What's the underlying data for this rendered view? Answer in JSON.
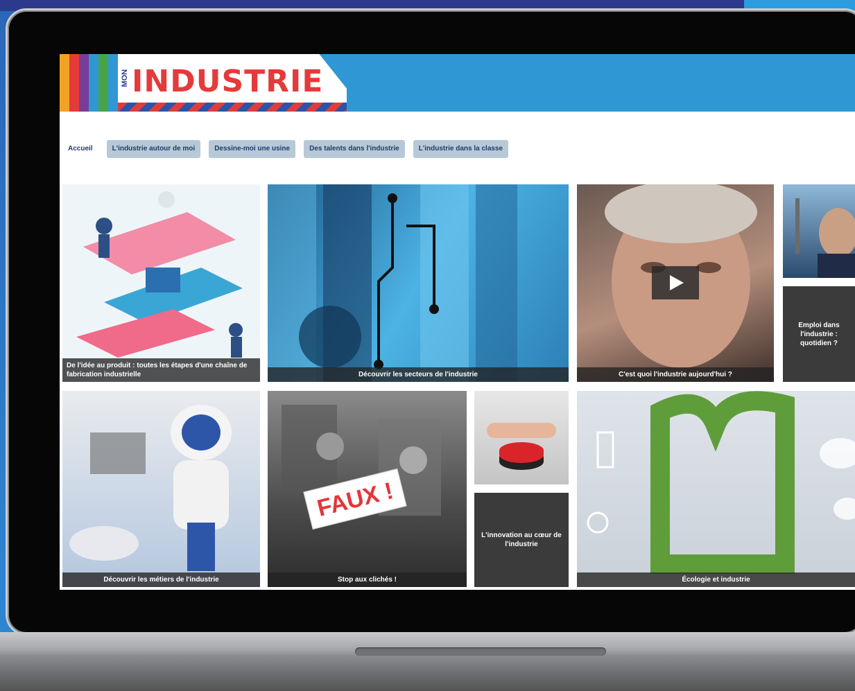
{
  "logo": {
    "mon": "MON",
    "industrie": "INDUSTRIE"
  },
  "stripes": [
    "#f2a323",
    "#e53a3a",
    "#7a3d97",
    "#2f97d3",
    "#47a548"
  ],
  "nav": {
    "items": [
      {
        "label": "Accueil"
      },
      {
        "label": "L'industrie autour de moi"
      },
      {
        "label": "Dessine-moi une usine"
      },
      {
        "label": "Des talents dans l'industrie"
      },
      {
        "label": "L'industrie dans la classe"
      }
    ]
  },
  "tiles": {
    "t1": {
      "caption": "De l'idée au produit : toutes les étapes d'une chaîne de fabrication industrielle"
    },
    "t2": {
      "caption": "Découvrir les secteurs de l'industrie"
    },
    "t3": {
      "caption": "C'est quoi l'industrie aujourd'hui ?"
    },
    "t4": {
      "text": "Emploi dans l'industrie : quotidien ?"
    },
    "t5": {
      "caption": "Découvrir les métiers de l'industrie"
    },
    "t6": {
      "caption": "Stop aux clichés !",
      "stamp": "FAUX !"
    },
    "t7": {
      "text": "L'innovation au cœur de l'industrie"
    },
    "t8": {
      "caption": "Écologie et industrie"
    }
  }
}
